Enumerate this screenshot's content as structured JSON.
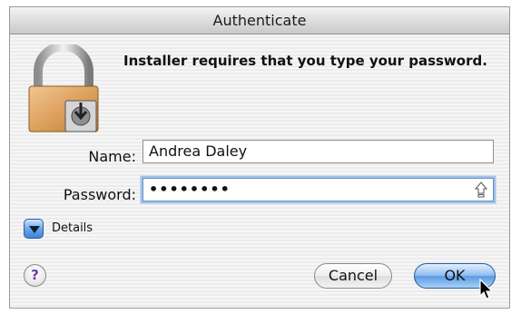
{
  "window": {
    "title": "Authenticate"
  },
  "message": "Installer requires that you type your password.",
  "form": {
    "name_label": "Name:",
    "name_value": "Andrea Daley",
    "password_label": "Password:",
    "password_value": "••••••••"
  },
  "details": {
    "label": "Details"
  },
  "buttons": {
    "help": "?",
    "cancel": "Cancel",
    "ok": "OK"
  },
  "icons": {
    "lock": "padlock-icon",
    "caps_lock": "caps-lock-icon",
    "disclosure": "disclosure-triangle-icon",
    "cursor": "mouse-pointer-icon"
  },
  "colors": {
    "accent": "#5a9ae3",
    "focus_ring": "#9fc2ea",
    "help_glyph": "#6a3aa8"
  }
}
